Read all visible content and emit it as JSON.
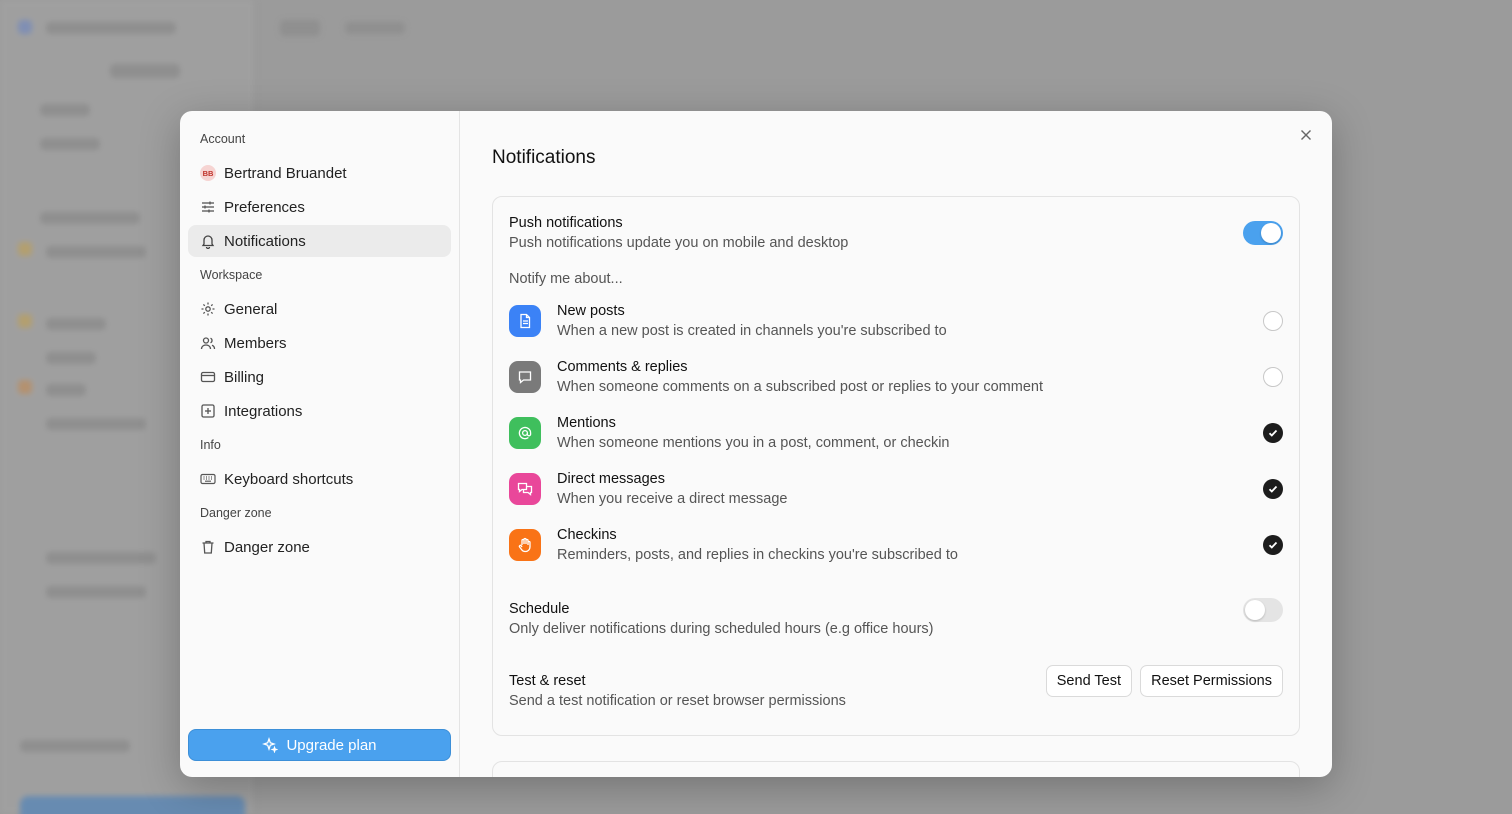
{
  "sidebar": {
    "sections": {
      "account": "Account",
      "workspace": "Workspace",
      "info": "Info",
      "danger": "Danger zone"
    },
    "items": {
      "user": {
        "label": "Bertrand Bruandet",
        "initials": "BB"
      },
      "preferences": {
        "label": "Preferences",
        "icon": "sliders-icon"
      },
      "notifications": {
        "label": "Notifications",
        "icon": "bell-icon",
        "active": true
      },
      "general": {
        "label": "General",
        "icon": "gear-icon"
      },
      "members": {
        "label": "Members",
        "icon": "users-icon"
      },
      "billing": {
        "label": "Billing",
        "icon": "credit-card-icon"
      },
      "integrations": {
        "label": "Integrations",
        "icon": "plus-square-icon"
      },
      "shortcuts": {
        "label": "Keyboard shortcuts",
        "icon": "keyboard-icon"
      },
      "danger": {
        "label": "Danger zone",
        "icon": "trash-icon"
      }
    },
    "upgrade_label": "Upgrade plan"
  },
  "main": {
    "title": "Notifications",
    "push": {
      "title": "Push notifications",
      "desc": "Push notifications update you on mobile and desktop",
      "enabled": true
    },
    "notify_label": "Notify me about...",
    "rows": [
      {
        "title": "New posts",
        "desc": "When a new post is created in channels you're subscribed to",
        "icon": "document-icon",
        "color": "#3b82f6",
        "checked": false
      },
      {
        "title": "Comments & replies",
        "desc": "When someone comments on a subscribed post or replies to your comment",
        "icon": "comment-icon",
        "color": "#7a7a7a",
        "checked": false
      },
      {
        "title": "Mentions",
        "desc": "When someone mentions you in a post, comment, or checkin",
        "icon": "at-icon",
        "color": "#3fbf5d",
        "checked": true
      },
      {
        "title": "Direct messages",
        "desc": "When you receive a direct message",
        "icon": "chat-bubbles-icon",
        "color": "#e9479a",
        "checked": true
      },
      {
        "title": "Checkins",
        "desc": "Reminders, posts, and replies in checkins you're subscribed to",
        "icon": "hand-icon",
        "color": "#f97316",
        "checked": true
      }
    ],
    "schedule": {
      "title": "Schedule",
      "desc": "Only deliver notifications during scheduled hours (e.g office hours)",
      "enabled": false
    },
    "test": {
      "title": "Test & reset",
      "desc": "Send a test notification or reset browser permissions",
      "send_label": "Send Test",
      "reset_label": "Reset Permissions"
    }
  }
}
